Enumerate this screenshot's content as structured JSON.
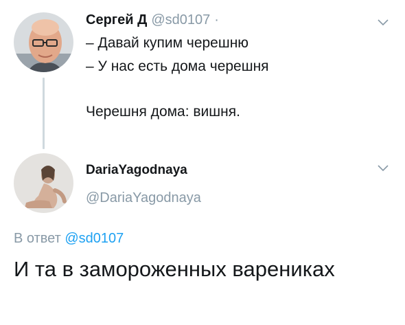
{
  "tweet_1": {
    "author_name": "Сергей Д",
    "author_handle": "@sd0107",
    "separator": "·",
    "lines": [
      "– Давай купим черешню",
      "– У нас есть дома черешня",
      "Черешня дома: вишня."
    ],
    "menu_icon": "chevron-down-icon"
  },
  "tweet_2": {
    "author_name": "DariaYagodnaya",
    "author_handle": "@DariaYagodnaya",
    "reply_prefix": "В ответ",
    "reply_mention": "@sd0107",
    "text": "И та в замороженных варениках",
    "menu_icon": "chevron-down-icon"
  },
  "colors": {
    "text": "#14171a",
    "secondary": "#8899a6",
    "link": "#1da1f2",
    "thread_line": "#cfd9de"
  }
}
